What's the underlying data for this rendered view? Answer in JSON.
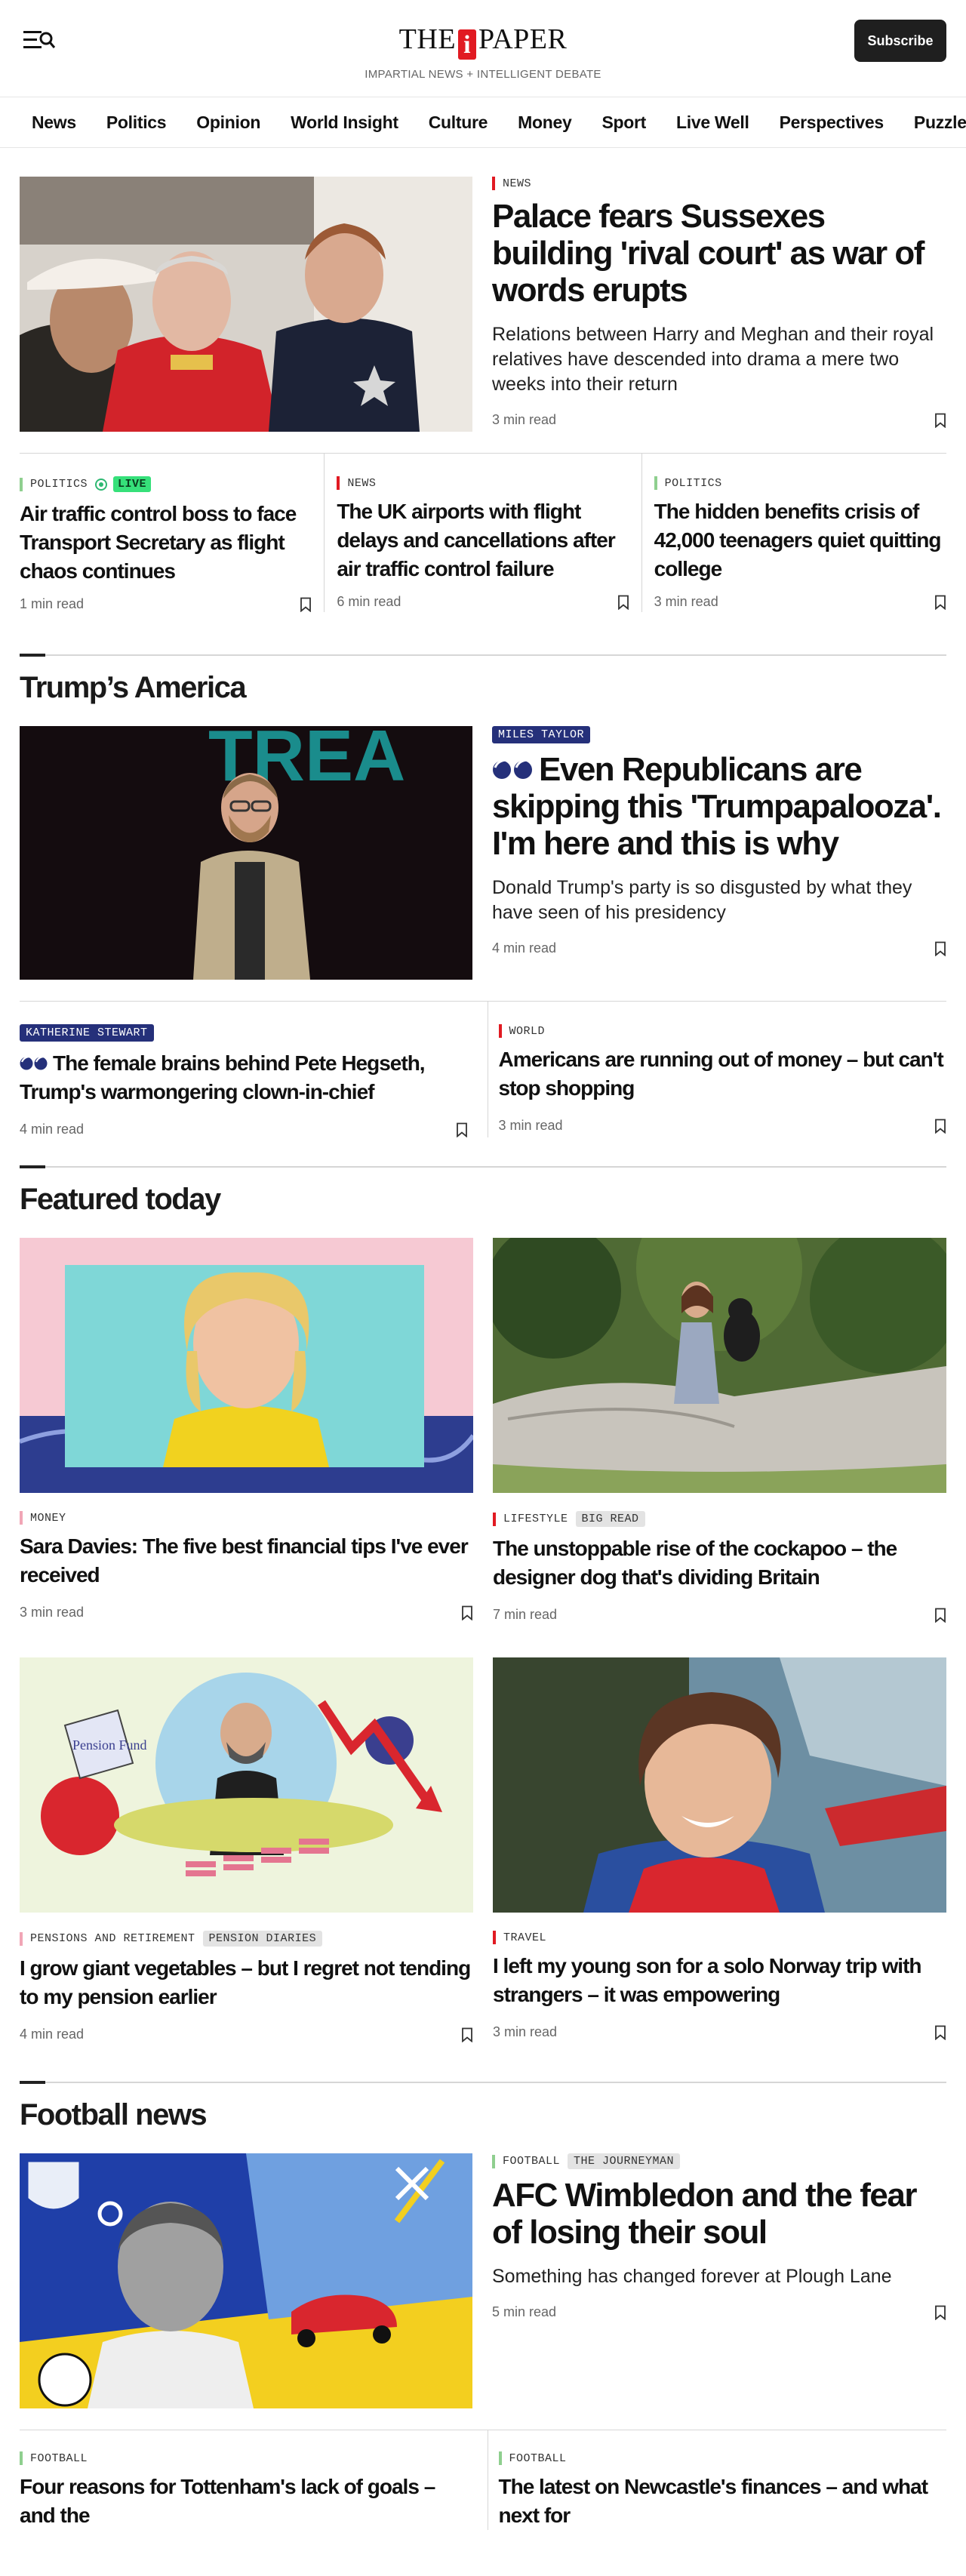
{
  "header": {
    "logo_left": "THE",
    "logo_i": "i",
    "logo_right": "PAPER",
    "tagline": "IMPARTIAL NEWS + INTELLIGENT DEBATE",
    "subscribe_label": "Subscribe"
  },
  "nav": [
    "News",
    "Politics",
    "Opinion",
    "World Insight",
    "Culture",
    "Money",
    "Sport",
    "Live Well",
    "Perspectives",
    "Puzzles"
  ],
  "lead": {
    "section": "NEWS",
    "headline": "Palace fears Sussexes building 'rival court' as war of words erupts",
    "standfirst": "Relations between Harry and Meghan and their royal relatives have descended into drama a mere two weeks into their return",
    "read_time": "3 min read"
  },
  "top_row": [
    {
      "section": "POLITICS",
      "live": "LIVE",
      "headline": "Air traffic control boss to face Transport Secretary as flight chaos continues",
      "read_time": "1 min read"
    },
    {
      "section": "NEWS",
      "headline": "The UK airports with flight delays and cancellations after air traffic control failure",
      "read_time": "6 min read"
    },
    {
      "section": "POLITICS",
      "headline": "The hidden benefits crisis of 42,000 teenagers quiet quitting college",
      "read_time": "3 min read"
    }
  ],
  "trump": {
    "title": "Trump’s America",
    "lead": {
      "author": "MILES TAYLOR",
      "headline": "Even Republicans are skipping this 'Trumpapalooza'. I'm here and this is why",
      "standfirst": "Donald Trump's party is so disgusted by what they have seen of his presidency",
      "read_time": "4 min read",
      "bg_word": "TREA"
    },
    "row": [
      {
        "author": "KATHERINE STEWART",
        "headline": "The female brains behind Pete Hegseth, Trump's warmongering clown-in-chief",
        "read_time": "4 min read"
      },
      {
        "section": "WORLD",
        "headline": "Americans are running out of money – but can't stop shopping",
        "read_time": "3 min read"
      }
    ]
  },
  "featured": {
    "title": "Featured today",
    "cards": [
      {
        "section": "MONEY",
        "headline": "Sara Davies: The five best financial tips I've ever received",
        "read_time": "3 min read"
      },
      {
        "section": "LIFESTYLE",
        "tag": "BIG READ",
        "headline": "The unstoppable rise of the cockapoo – the designer dog that's dividing Britain",
        "read_time": "7 min read"
      },
      {
        "section": "PENSIONS AND RETIREMENT",
        "tag": "PENSION DIARIES",
        "headline": "I grow giant vegetables – but I regret not tending to my pension earlier",
        "read_time": "4 min read",
        "img_label": "Pension Fund"
      },
      {
        "section": "TRAVEL",
        "headline": "I left my young son for a solo Norway trip with strangers – it was empowering",
        "read_time": "3 min read"
      }
    ]
  },
  "football": {
    "title": "Football news",
    "lead": {
      "section": "FOOTBALL",
      "tag": "THE JOURNEYMAN",
      "headline": "AFC Wimbledon and the fear of losing their soul",
      "standfirst": "Something has changed forever at Plough Lane",
      "read_time": "5 min read"
    },
    "row": [
      {
        "section": "FOOTBALL",
        "headline": "Four reasons for Tottenham's lack of goals – and the"
      },
      {
        "section": "FOOTBALL",
        "headline": "The latest on Newcastle's finances – and what next for"
      }
    ]
  }
}
